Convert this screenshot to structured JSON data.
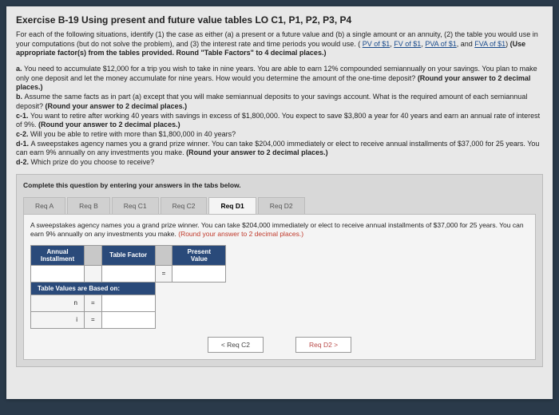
{
  "title": "Exercise B-19 Using present and future value tables LO C1, P1, P2, P3, P4",
  "intro": {
    "lead": "For each of the following situations, identify (1) the case as either (a) a present or a future value and (b) a single amount or an annuity, (2) the table you would use in your computations (but do not solve the problem), and (3) the interest rate and time periods you would use. (",
    "links": [
      "PV of $1",
      "FV of $1",
      "PVA of $1",
      "FVA of $1"
    ],
    "tail": ") ",
    "bold_tail": "(Use appropriate factor(s) from the tables provided. Round \"Table Factors\" to 4 decimal places.)"
  },
  "parts": {
    "a": "You need to accumulate $12,000 for a trip you wish to take in nine years. You are able to earn 12% compounded semiannually on your savings. You plan to make only one deposit and let the money accumulate for nine years. How would you determine the amount of the one-time deposit?",
    "a_hint": "(Round your answer to 2 decimal places.)",
    "b": "Assume the same facts as in part (a) except that you will make semiannual deposits to your savings account. What is the required amount of each semiannual deposit?",
    "b_hint": "(Round your answer to 2 decimal places.)",
    "c1": "You want to retire after working 40 years with savings in excess of $1,800,000. You expect to save $3,800 a year for 40 years and earn an annual rate of interest of 9%.",
    "c1_hint": "(Round your answer to 2 decimal places.)",
    "c2": "Will you be able to retire with more than $1,800,000 in 40 years?",
    "d1": "A sweepstakes agency names you a grand prize winner. You can take $204,000 immediately or elect to receive annual installments of $37,000 for 25 years. You can earn 9% annually on any investments you make.",
    "d1_hint": "(Round your answer to 2 decimal places.)",
    "d2": "Which prize do you choose to receive?"
  },
  "answer": {
    "instruction": "Complete this question by entering your answers in the tabs below.",
    "tabs": [
      "Req A",
      "Req B",
      "Req C1",
      "Req C2",
      "Req D1",
      "Req D2"
    ],
    "active_prompt": "A sweepstakes agency names you a grand prize winner. You can take $204,000 immediately or elect to receive annual installments of $37,000 for 25 years. You can earn 9% annually on any investments you make.",
    "active_hint": "(Round your answer to 2 decimal places.)",
    "col_headers": [
      "Annual Installment",
      "Table Factor",
      "Present Value"
    ],
    "row_header": "Table Values are Based on:",
    "row_labels": [
      "n",
      "i"
    ],
    "eq": "=",
    "nav_prev": "<  Req C2",
    "nav_next": "Req D2  >"
  }
}
